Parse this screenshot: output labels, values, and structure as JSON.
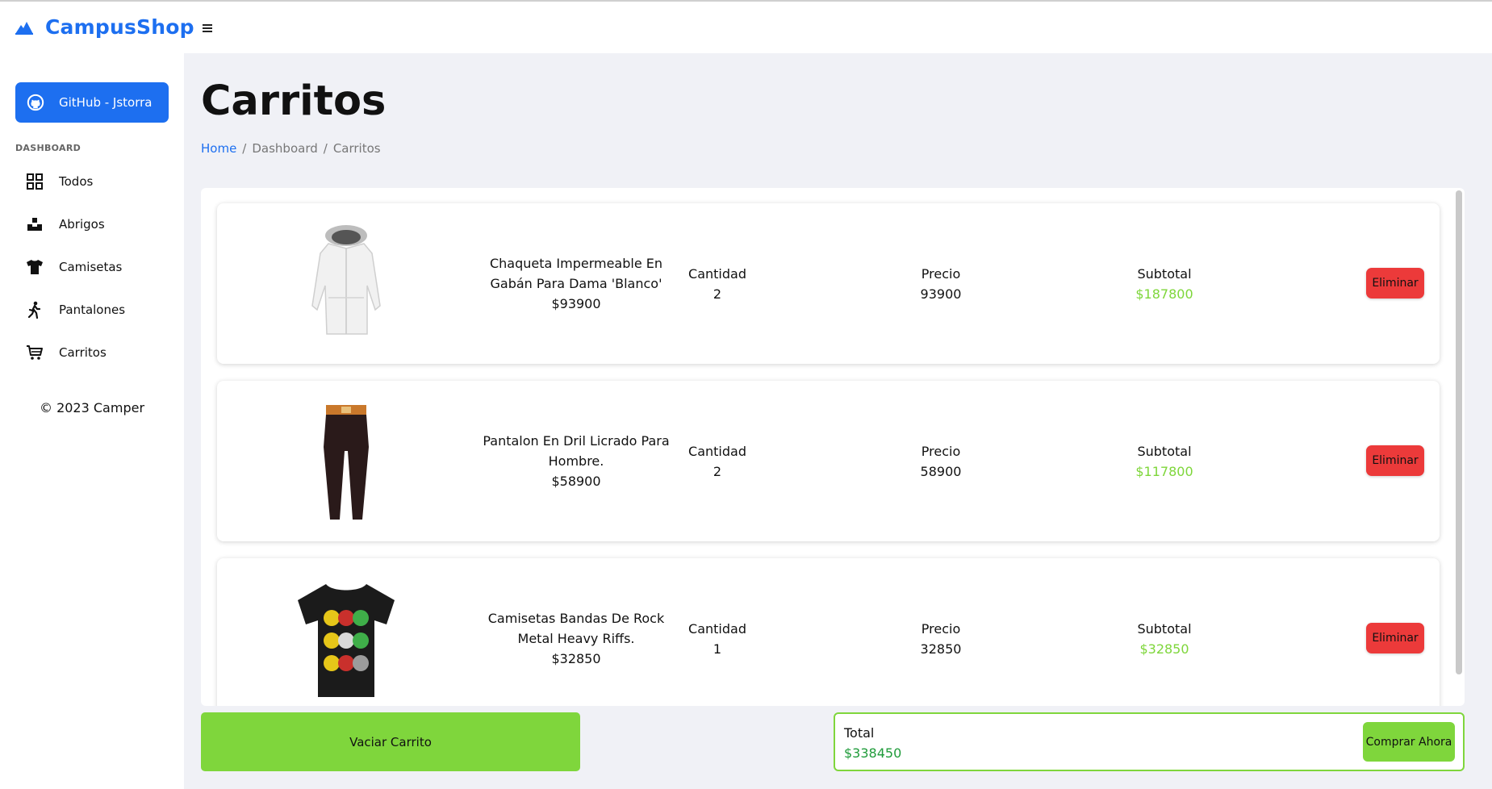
{
  "brand": {
    "name": "CampusShop",
    "icon": "mountain-icon",
    "color": "#1d6ff0"
  },
  "header": {
    "menu_icon": "hamburger-icon"
  },
  "sidebar": {
    "github_label": "GitHub - Jstorra",
    "section_label": "DASHBOARD",
    "items": [
      {
        "label": "Todos",
        "icon": "grid-icon"
      },
      {
        "label": "Abrigos",
        "icon": "box-icon"
      },
      {
        "label": "Camisetas",
        "icon": "shirt-icon"
      },
      {
        "label": "Pantalones",
        "icon": "walking-icon"
      },
      {
        "label": "Carritos",
        "icon": "cart-icon"
      }
    ],
    "copyright": "© 2023 Camper"
  },
  "page": {
    "title": "Carritos",
    "breadcrumb": [
      "Home",
      "/",
      "Dashboard",
      "/",
      "Carritos"
    ]
  },
  "cart": {
    "items": [
      {
        "name_line1": "Chaqueta Impermeable En",
        "name_line2": "Gabán Para Dama 'Blanco'",
        "price_line": "$93900",
        "qty_label": "Cantidad",
        "qty": "2",
        "price_label": "Precio",
        "price": "93900",
        "subtotal_label": "Subtotal",
        "subtotal": "$187800",
        "delete_label": "Eliminar",
        "image": "jacket-image"
      },
      {
        "name_line1": "Pantalon En Dril Licrado Para",
        "name_line2": "Hombre.",
        "price_line": "$58900",
        "qty_label": "Cantidad",
        "qty": "2",
        "price_label": "Precio",
        "price": "58900",
        "subtotal_label": "Subtotal",
        "subtotal": "$117800",
        "delete_label": "Eliminar",
        "image": "pants-image"
      },
      {
        "name_line1": "Camisetas Bandas De Rock",
        "name_line2": "Metal Heavy Riffs.",
        "price_line": "$32850",
        "qty_label": "Cantidad",
        "qty": "1",
        "price_label": "Precio",
        "price": "32850",
        "subtotal_label": "Subtotal",
        "subtotal": "$32850",
        "delete_label": "Eliminar",
        "image": "tshirt-image"
      }
    ],
    "empty_label": "Vaciar Carrito",
    "total_label": "Total",
    "total_value": "$338450",
    "buy_label": "Comprar Ahora"
  },
  "colors": {
    "accent": "#1d6ff0",
    "green": "#7fd63c",
    "danger": "#ec3a3a",
    "total_green": "#1f9b3a"
  }
}
